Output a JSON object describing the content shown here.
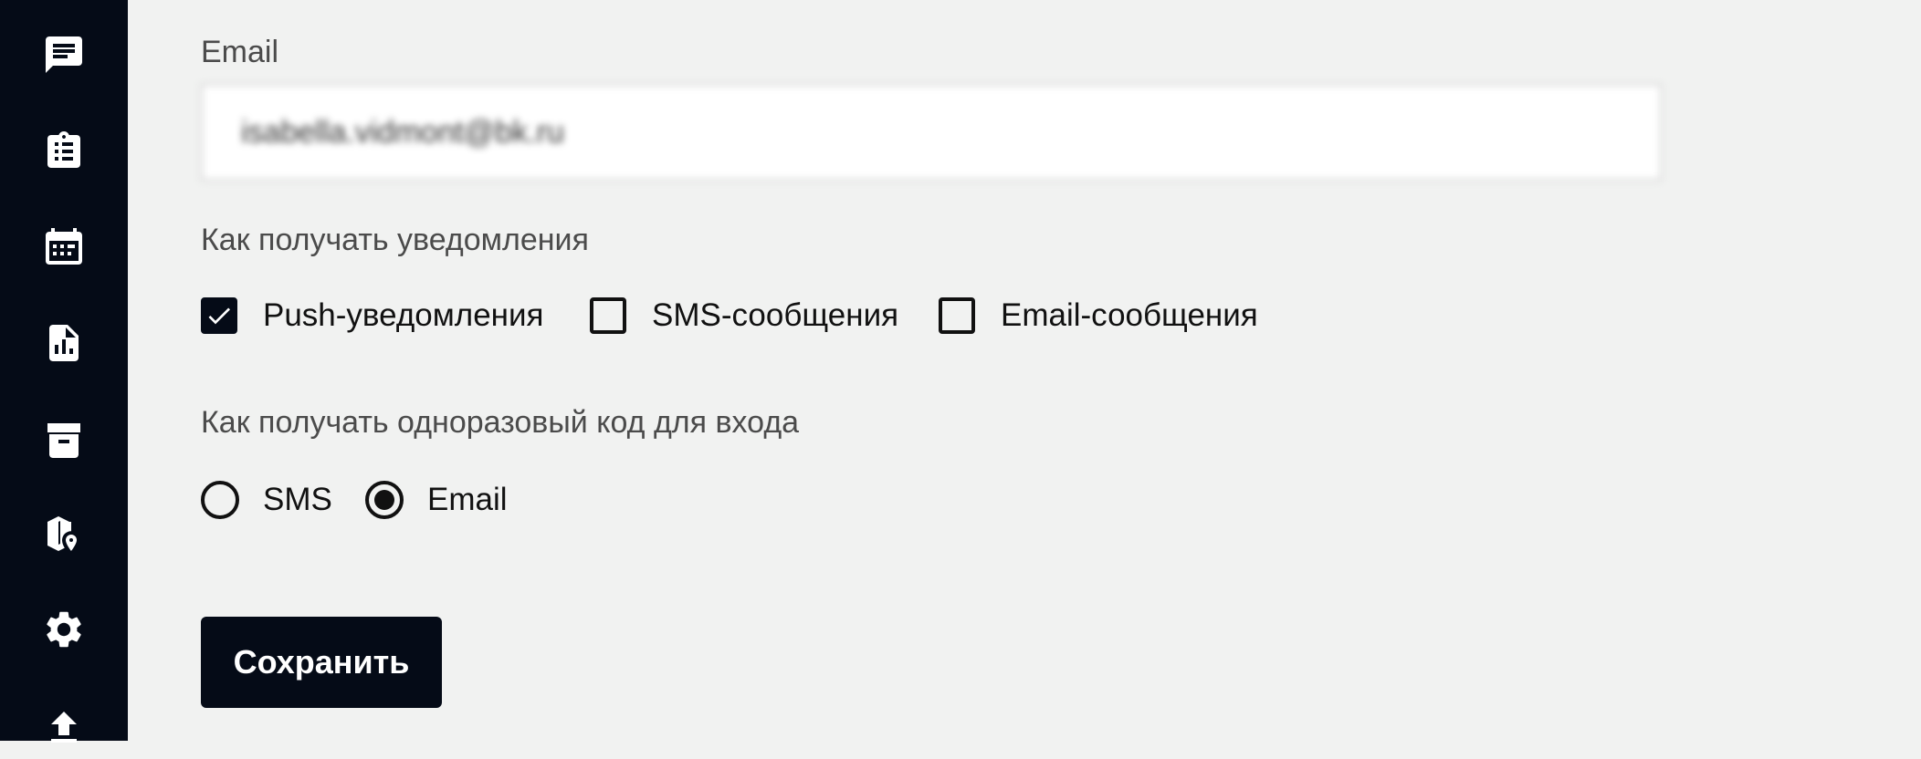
{
  "sidebar": {
    "icons": [
      {
        "name": "messages-icon"
      },
      {
        "name": "clipboard-list-icon"
      },
      {
        "name": "calendar-icon"
      },
      {
        "name": "report-file-icon"
      },
      {
        "name": "archive-box-icon"
      },
      {
        "name": "map-marker-icon"
      },
      {
        "name": "settings-gear-icon"
      },
      {
        "name": "upload-icon"
      }
    ]
  },
  "email": {
    "label": "Email",
    "value": "isabella.vidmont@bk.ru"
  },
  "notifications": {
    "heading": "Как получать уведомления",
    "options": [
      {
        "label": "Push-уведомления",
        "checked": true
      },
      {
        "label": "SMS-сообщения",
        "checked": false
      },
      {
        "label": "Email-сообщения",
        "checked": false
      }
    ]
  },
  "otp": {
    "heading": "Как получать одноразовый код для входа",
    "options": [
      {
        "label": "SMS",
        "selected": false
      },
      {
        "label": "Email",
        "selected": true
      }
    ]
  },
  "save_button": {
    "label": "Сохранить"
  },
  "colors": {
    "sidebar_bg": "#050b17",
    "page_bg": "#f1f2f1",
    "button_bg": "#050b17"
  }
}
